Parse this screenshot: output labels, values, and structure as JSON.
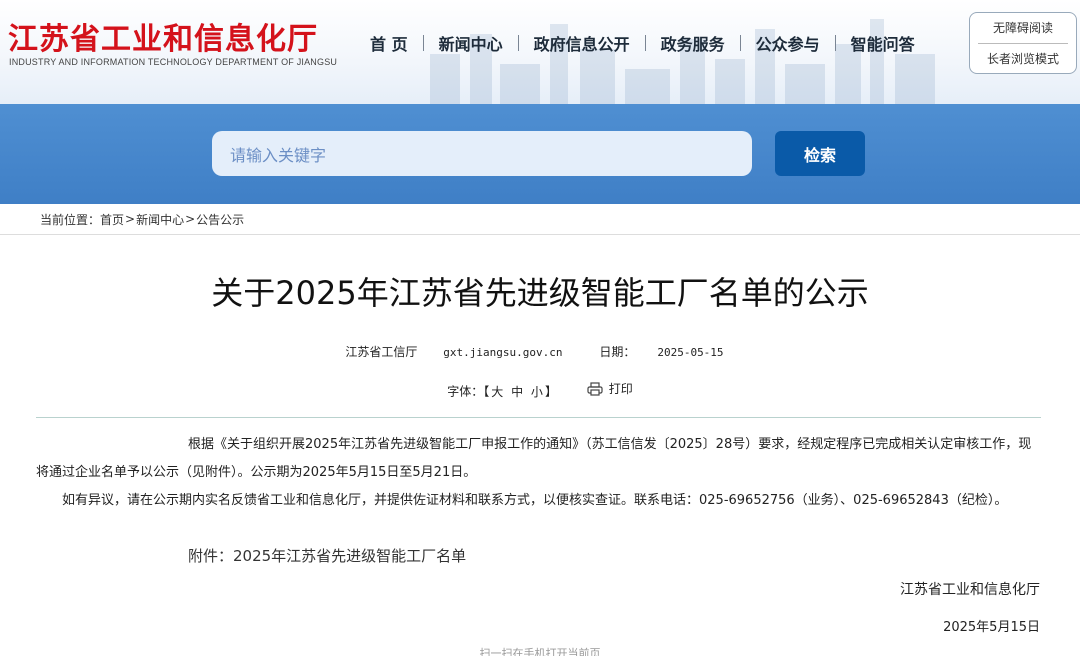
{
  "header": {
    "logo_cn": "江苏省工业和信息化厅",
    "logo_en": "INDUSTRY AND INFORMATION TECHNOLOGY DEPARTMENT OF JIANGSU",
    "nav": [
      "首 页",
      "新闻中心",
      "政府信息公开",
      "政务服务",
      "公众参与",
      "智能问答"
    ],
    "accessibility": {
      "barrier_free": "无障碍阅读",
      "elder_mode": "长者浏览模式"
    }
  },
  "search": {
    "placeholder": "请输入关键字",
    "button": "检索"
  },
  "breadcrumb": {
    "prefix": "当前位置：",
    "items": [
      "首页",
      "新闻中心",
      "公告公示"
    ],
    "separator": ">"
  },
  "article": {
    "title": "关于2025年江苏省先进级智能工厂名单的公示",
    "source": "江苏省工信厅",
    "site": "gxt.jiangsu.gov.cn",
    "date_label": "日期：",
    "date": "2025-05-15",
    "font_label": "字体：",
    "font_open": "【",
    "font_large": "大",
    "font_medium": "中",
    "font_small": "小",
    "font_close": "】",
    "print": "打印",
    "para1": "根据《关于组织开展2025年江苏省先进级智能工厂申报工作的通知》（苏工信信发〔2025〕28号）要求，经规定程序已完成相关认定审核工作，现将通过企业名单予以公示（见附件）。公示期为2025年5月15日至5月21日。",
    "para2": "如有异议，请在公示期内实名反馈省工业和信息化厅，并提供佐证材料和联系方式，以便核实查证。联系电话：025-69652756（业务）、025-69652843（纪检）。",
    "attachment": "附件：2025年江苏省先进级智能工厂名单",
    "sign_org": "江苏省工业和信息化厅",
    "sign_date": "2025年5月15日"
  },
  "footer": {
    "qr_hint": "扫一扫在手机打开当前页"
  },
  "colors": {
    "brand_red": "#d4121b",
    "banner_blue": "#4585cb",
    "button_blue": "#0a5aa8"
  }
}
